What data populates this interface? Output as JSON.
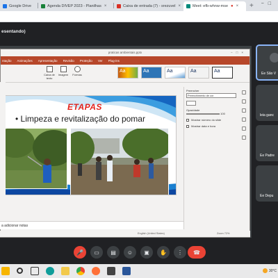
{
  "browser": {
    "tabs": [
      {
        "title": "Google Drive",
        "color": "#1a73e8"
      },
      {
        "title": "Agenda DIVEP 2023 - Planilhas",
        "color": "#188038"
      },
      {
        "title": "Caixa de entrada (7) - srezuvel",
        "color": "#d93025"
      },
      {
        "title": "Meet: efb-whnw-mse",
        "color": "#00897b",
        "active": true
      }
    ],
    "new_tab": "+"
  },
  "meet": {
    "presenting_label": "esentando)",
    "participants": [
      {
        "name": "Ee São V"
      },
      {
        "name": "leia ganc"
      },
      {
        "name": "Ee Padre"
      },
      {
        "name": "Ee Depu"
      }
    ]
  },
  "ppt": {
    "window_title": "praticas ambientais.pptx",
    "ribbon_tabs": [
      "ntação",
      "Animações",
      "Apresentação",
      "Revisão",
      "Proteção",
      "Ver",
      "Plug-ins"
    ],
    "ribbon_buttons": [
      "Caixa de texto",
      "Imagem",
      "Formas"
    ],
    "themes": [
      "Aa",
      "Aa",
      "Aa",
      "Aa",
      "Aa"
    ],
    "format_pane": {
      "fill_label": "Preencher",
      "fill_value": "Preenchimento de cor",
      "opacity_label": "Opacidade",
      "opacity_value": "100",
      "check1": "Mostrar número do slide",
      "check2": "Mostrar data e hora"
    },
    "notes_placeholder": "a adicionar notas",
    "status_left": "English (United States)",
    "status_zoom": "Zoom 72%"
  },
  "slide": {
    "title": "ETAPAS",
    "bullet": "• Limpeza e revitalização do pomar"
  },
  "taskbar": {
    "weather": "30°C",
    "lang": "POR"
  }
}
